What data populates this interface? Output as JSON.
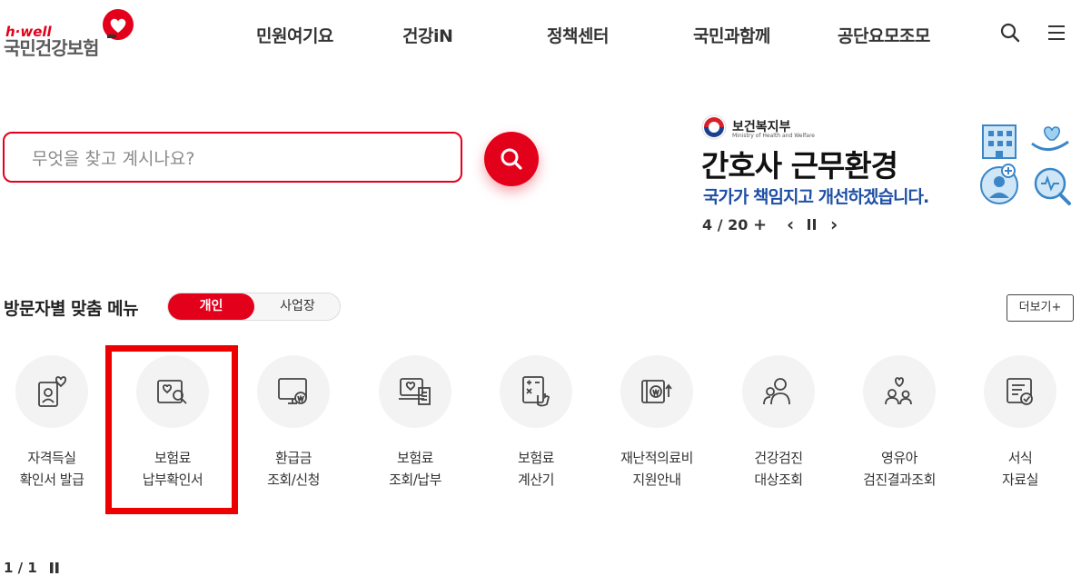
{
  "header": {
    "logo_tagline": "h·well",
    "logo_name": "국민건강보험",
    "nav": [
      "민원여기요",
      "건강iN",
      "정책센터",
      "국민과함께",
      "공단요모조모"
    ],
    "icons": [
      "search-icon",
      "menu-icon"
    ]
  },
  "search": {
    "placeholder": "무엇을 찾고 계시나요?"
  },
  "banner": {
    "ministry_ko": "보건복지부",
    "ministry_en": "Ministry of Health and Welfare",
    "title": "간호사 근무환경",
    "subtitle": "국가가 책임지고 개선하겠습니다.",
    "counter": "4 / 20",
    "plus": "+",
    "prev": "‹",
    "next": "›"
  },
  "section": {
    "title": "방문자별 맞춤 메뉴",
    "tabs": [
      "개인",
      "사업장"
    ],
    "active_tab": "개인",
    "more": "더보기+"
  },
  "menu": [
    {
      "line1": "자격득실",
      "line2": "확인서 발급",
      "icon": "id-card-heart-icon"
    },
    {
      "line1": "보험료",
      "line2": "납부확인서",
      "icon": "document-search-icon"
    },
    {
      "line1": "환급금",
      "line2": "조회/신청",
      "icon": "monitor-won-icon"
    },
    {
      "line1": "보험료",
      "line2": "조회/납부",
      "icon": "laptop-receipt-icon"
    },
    {
      "line1": "보험료",
      "line2": "계산기",
      "icon": "calculator-icon"
    },
    {
      "line1": "재난적의료비",
      "line2": "지원안내",
      "icon": "wallet-won-icon"
    },
    {
      "line1": "건강검진",
      "line2": "대상조회",
      "icon": "people-search-icon"
    },
    {
      "line1": "영유아",
      "line2": "검진결과조회",
      "icon": "family-heart-icon"
    },
    {
      "line1": "서식",
      "line2": "자료실",
      "icon": "form-document-icon"
    }
  ],
  "pager": {
    "counter": "1 / 1"
  },
  "colors": {
    "brand_red": "#e3001b",
    "banner_blue": "#1e4fa6"
  }
}
